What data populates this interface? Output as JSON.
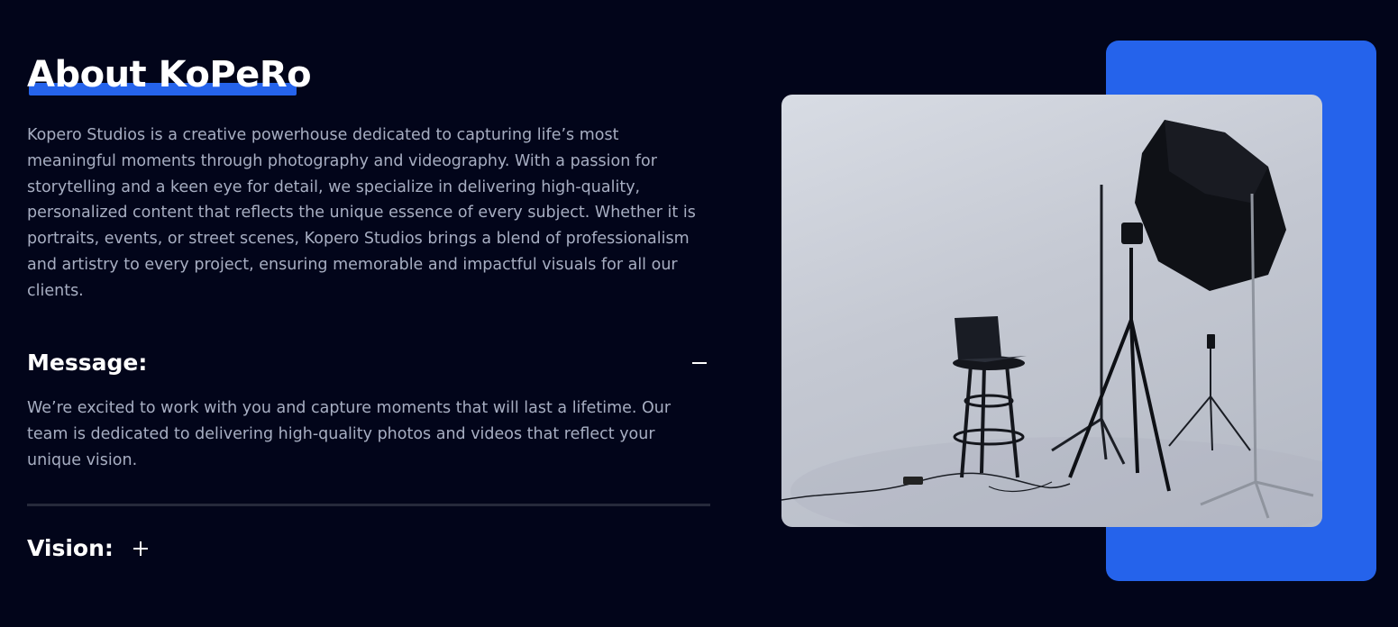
{
  "about": {
    "title": "About KoPeRo",
    "intro": "Kopero Studios is a creative powerhouse dedicated to capturing life’s most meaningful moments through photography and videography. With a passion for storytelling and a keen eye for detail, we specialize in delivering high-quality, personalized content that reflects the unique essence of every subject. Whether it is portraits, events, or street scenes, Kopero Studios brings a blend of professionalism and artistry to every project, ensuring memorable and impactful visuals for all our clients."
  },
  "accordion": {
    "message": {
      "title": "Message:",
      "body": "We’re excited to work with you and capture moments that will last a lifetime. Our team is dedicated to delivering high-quality photos and videos that reflect your unique vision.",
      "toggle_icon": "minus-icon",
      "expanded": true
    },
    "vision": {
      "title": "Vision:",
      "toggle_icon": "plus-icon",
      "expanded": false
    }
  },
  "colors": {
    "background": "#02051a",
    "accent": "#2563eb",
    "text": "#ffffff",
    "muted_text": "#a7aec2"
  },
  "image": {
    "subject": "photo studio with softbox, tripods, stool and laptop"
  }
}
